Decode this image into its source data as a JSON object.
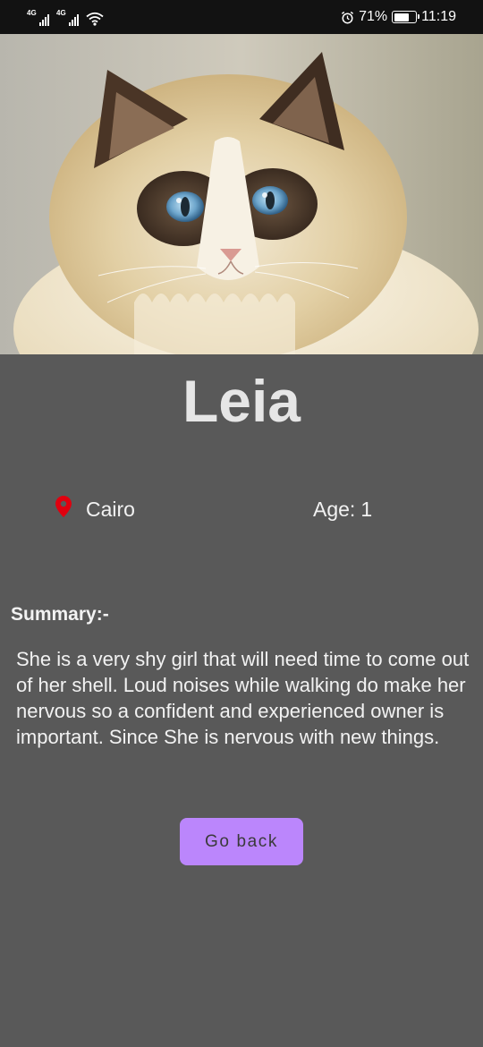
{
  "status_bar": {
    "network_1": "4G",
    "network_2": "4G",
    "battery": "71%",
    "battery_level": 0.71,
    "time": "11:19",
    "icons": [
      "signal-icon",
      "signal-icon",
      "wifi-icon",
      "alarm-icon",
      "battery-icon"
    ]
  },
  "pet": {
    "name": "Leia",
    "location": "Cairo",
    "age_label": "Age:",
    "age_value": "1",
    "photo": "cat-photo"
  },
  "summary": {
    "heading": "Summary:-",
    "text": "She is a very shy girl that will need time to come out of her shell. Loud noises while walking do make her nervous so a confident and experienced owner is important. Since She is nervous with new things."
  },
  "actions": {
    "go_back_label": "Go back"
  },
  "colors": {
    "background": "#595959",
    "status_bar": "#121212",
    "button": "#bb86fc",
    "pin": "#e0000f",
    "name_text": "#e6e6e6"
  }
}
